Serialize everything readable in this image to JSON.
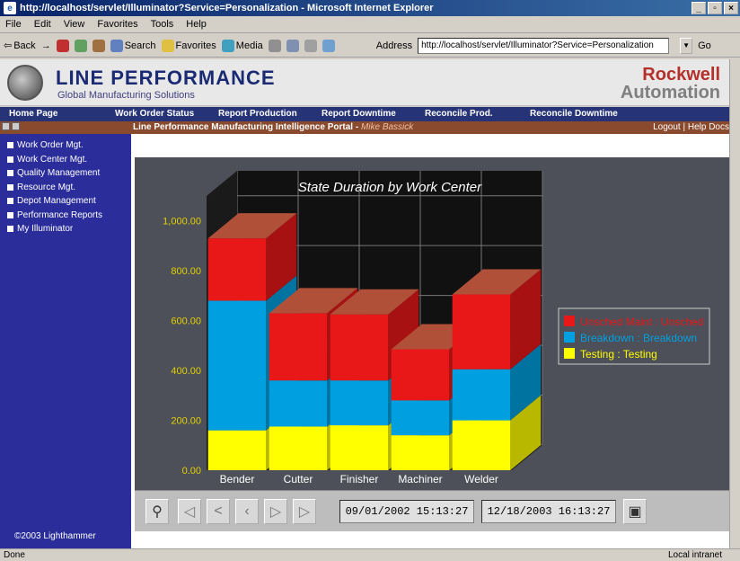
{
  "window": {
    "title": "http://localhost/servlet/Illuminator?Service=Personalization - Microsoft Internet Explorer",
    "controls": [
      "_",
      "▫",
      "×"
    ]
  },
  "menu": [
    "File",
    "Edit",
    "View",
    "Favorites",
    "Tools",
    "Help"
  ],
  "toolbar": {
    "back": "Back",
    "forward": "→",
    "search": "Search",
    "favorites": "Favorites",
    "media": "Media",
    "address_label": "Address",
    "address_value": "http://localhost/servlet/Illuminator?Service=Personalization",
    "go": "Go"
  },
  "header": {
    "title": "LINE PERFORMANCE",
    "subtitle": "Global Manufacturing Solutions",
    "company_line1": "Rockwell",
    "company_line2": "Automation"
  },
  "nav": [
    "Home Page",
    "Work Order Status",
    "Report Production",
    "Report Downtime",
    "Reconcile Prod.",
    "Reconcile Downtime"
  ],
  "subbar": {
    "title": "Line Performance Manufacturing Intelligence Portal - ",
    "user": "Mike Bassick",
    "logout": "Logout",
    "sep": "|",
    "help": "Help Docs"
  },
  "sidebar": {
    "items": [
      "Work Order Mgt.",
      "Work Center Mgt.",
      "Quality Management",
      "Resource Mgt.",
      "Depot Management",
      "Performance Reports",
      "My Illuminator"
    ],
    "copyright": "©2003 Lighthammer"
  },
  "chart_data": {
    "type": "bar",
    "stacked": true,
    "title": "State Duration by Work Center",
    "categories": [
      "Bender",
      "Cutter",
      "Finisher",
      "Machiner",
      "Welder"
    ],
    "series": [
      {
        "name": "Testing : Testing",
        "color": "#ffff00",
        "values": [
          160,
          175,
          180,
          140,
          200
        ]
      },
      {
        "name": "Breakdown : Breakdown",
        "color": "#00a0e0",
        "values": [
          520,
          185,
          180,
          140,
          205
        ]
      },
      {
        "name": "Unsched Maint : Unsched",
        "color": "#e81818",
        "values": [
          250,
          270,
          265,
          205,
          300
        ]
      }
    ],
    "yticks": [
      "0.00",
      "200.00",
      "400.00",
      "600.00",
      "800.00",
      "1,000.00"
    ],
    "ylim": [
      0,
      1100
    ],
    "legend_position": "right"
  },
  "controls": {
    "start": "09/01/2002 15:13:27",
    "end": "12/18/2003 16:13:27"
  },
  "status": {
    "left": "Done",
    "right": "Local intranet"
  }
}
